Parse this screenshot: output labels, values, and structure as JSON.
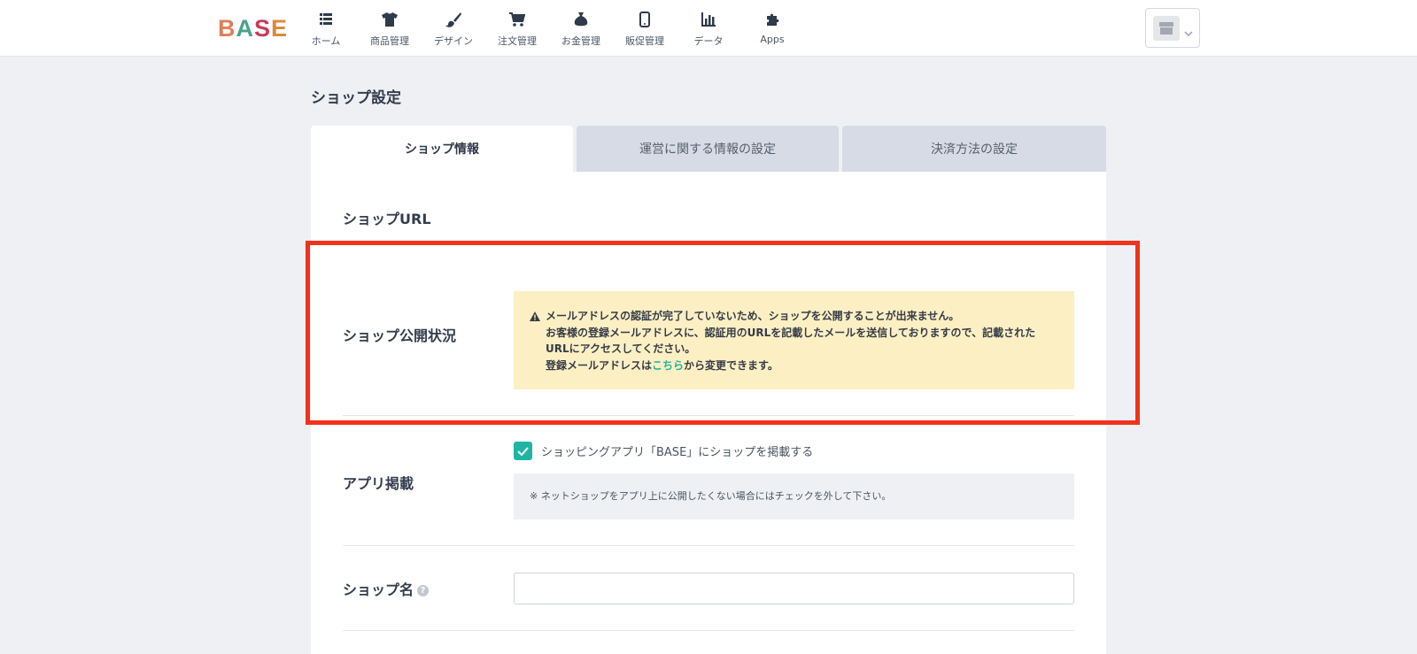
{
  "header": {
    "logo_text": [
      "B",
      "A",
      "S",
      "E"
    ],
    "nav": [
      {
        "label": "ホーム",
        "icon": "list-icon"
      },
      {
        "label": "商品管理",
        "icon": "tshirt-icon"
      },
      {
        "label": "デザイン",
        "icon": "brush-icon"
      },
      {
        "label": "注文管理",
        "icon": "cart-icon"
      },
      {
        "label": "お金管理",
        "icon": "money-bag-icon"
      },
      {
        "label": "販促管理",
        "icon": "smartphone-icon"
      },
      {
        "label": "データ",
        "icon": "bar-chart-icon"
      },
      {
        "label": "Apps",
        "icon": "puzzle-icon"
      }
    ],
    "shop_switch": {
      "icon": "store-icon",
      "chevron": "chevron-down-icon"
    }
  },
  "page": {
    "title": "ショップ設定",
    "tabs": [
      {
        "label": "ショップ情報",
        "active": true
      },
      {
        "label": "運営に関する情報の設定",
        "active": false
      },
      {
        "label": "決済方法の設定",
        "active": false
      }
    ]
  },
  "sections": {
    "shop_url": {
      "label": "ショップURL"
    },
    "publish_status": {
      "label": "ショップ公開状況",
      "warning": {
        "line1": "メールアドレスの認証が完了していないため、ショップを公開することが出来ません。",
        "line2": "お客様の登録メールアドレスに、認証用のURLを記載したメールを送信しておりますので、記載された",
        "line3": "URLにアクセスしてください。",
        "line4_prefix": "登録メールアドレスは",
        "line4_link": "こちら",
        "line4_suffix": "から変更できます。"
      }
    },
    "app_listing": {
      "label": "アプリ掲載",
      "checkbox_label": "ショッピングアプリ「BASE」にショップを掲載する",
      "checked": true,
      "note": "※  ネットショップをアプリ上に公開したくない場合にはチェックを外して下さい。"
    },
    "shop_name": {
      "label": "ショップ名",
      "help": "?",
      "value": ""
    }
  },
  "colors": {
    "accent": "#1fb5a3",
    "highlight": "#f2321c",
    "warning_bg": "#fdefc4",
    "tab_inactive": "#d6dbe5"
  }
}
